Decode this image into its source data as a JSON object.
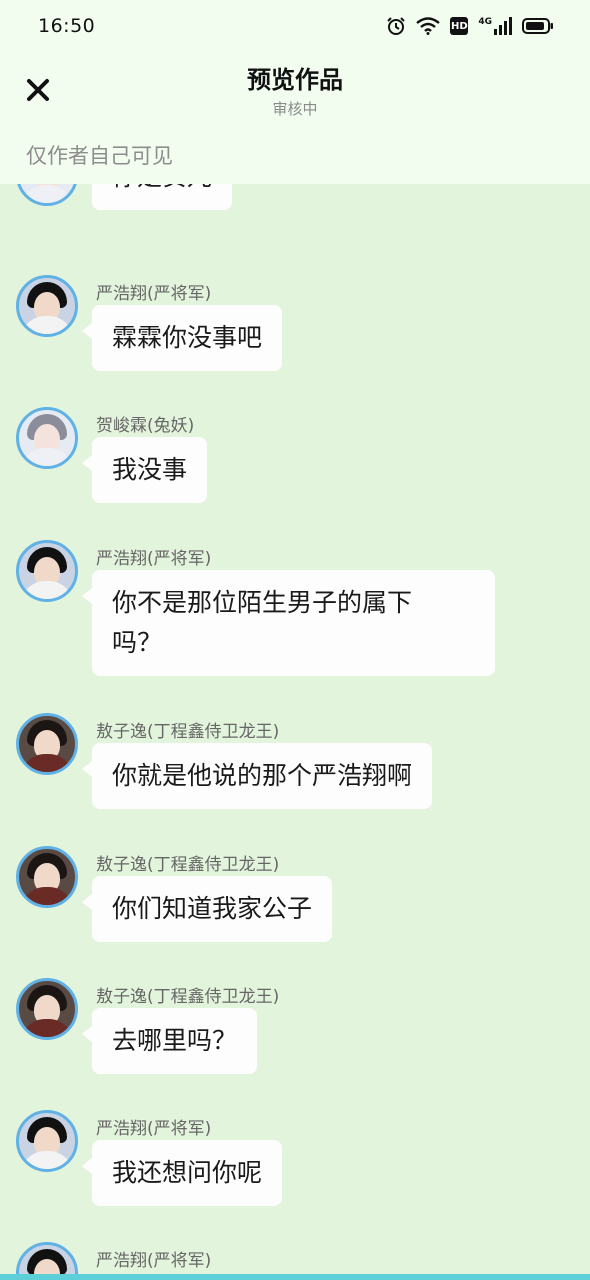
{
  "status_bar": {
    "time": "16:50",
    "icons": [
      "alarm-icon",
      "wifi-icon",
      "hd-icon",
      "signal-4g-icon",
      "battery-icon"
    ],
    "hd_label": "HD",
    "network_label": "4G"
  },
  "header": {
    "close_icon": "close-icon",
    "title": "预览作品",
    "subtitle": "审核中",
    "visibility_note": "仅作者自己可见"
  },
  "chat": {
    "messages": [
      {
        "sender": "",
        "text": "你是贺儿",
        "avatar": "he"
      },
      {
        "sender": "严浩翔(严将军)",
        "text": "霖霖你没事吧",
        "avatar": "yan"
      },
      {
        "sender": "贺峻霖(兔妖)",
        "text": "我没事",
        "avatar": "he"
      },
      {
        "sender": "严浩翔(严将军)",
        "text_line1": "你不是那位陌生男子的属下",
        "text_line2": "吗？",
        "avatar": "yan"
      },
      {
        "sender": "敖子逸(丁程鑫侍卫龙王)",
        "text": "你就是他说的那个严浩翔啊",
        "avatar": "ao"
      },
      {
        "sender": "敖子逸(丁程鑫侍卫龙王)",
        "text": "你们知道我家公子",
        "avatar": "ao"
      },
      {
        "sender": "敖子逸(丁程鑫侍卫龙王)",
        "text": "去哪里吗？",
        "avatar": "ao"
      },
      {
        "sender": "严浩翔(严将军)",
        "text": "我还想问你呢",
        "avatar": "yan"
      },
      {
        "sender": "严浩翔(严将军)",
        "text": "",
        "avatar": "yan"
      }
    ]
  },
  "colors": {
    "chat_background": "#e3f4dc",
    "header_background": "#f2fdf0",
    "avatar_ring": "#5fb1e6",
    "bubble": "#fdfdfd",
    "bottom_bar": "#5dcfd8"
  }
}
